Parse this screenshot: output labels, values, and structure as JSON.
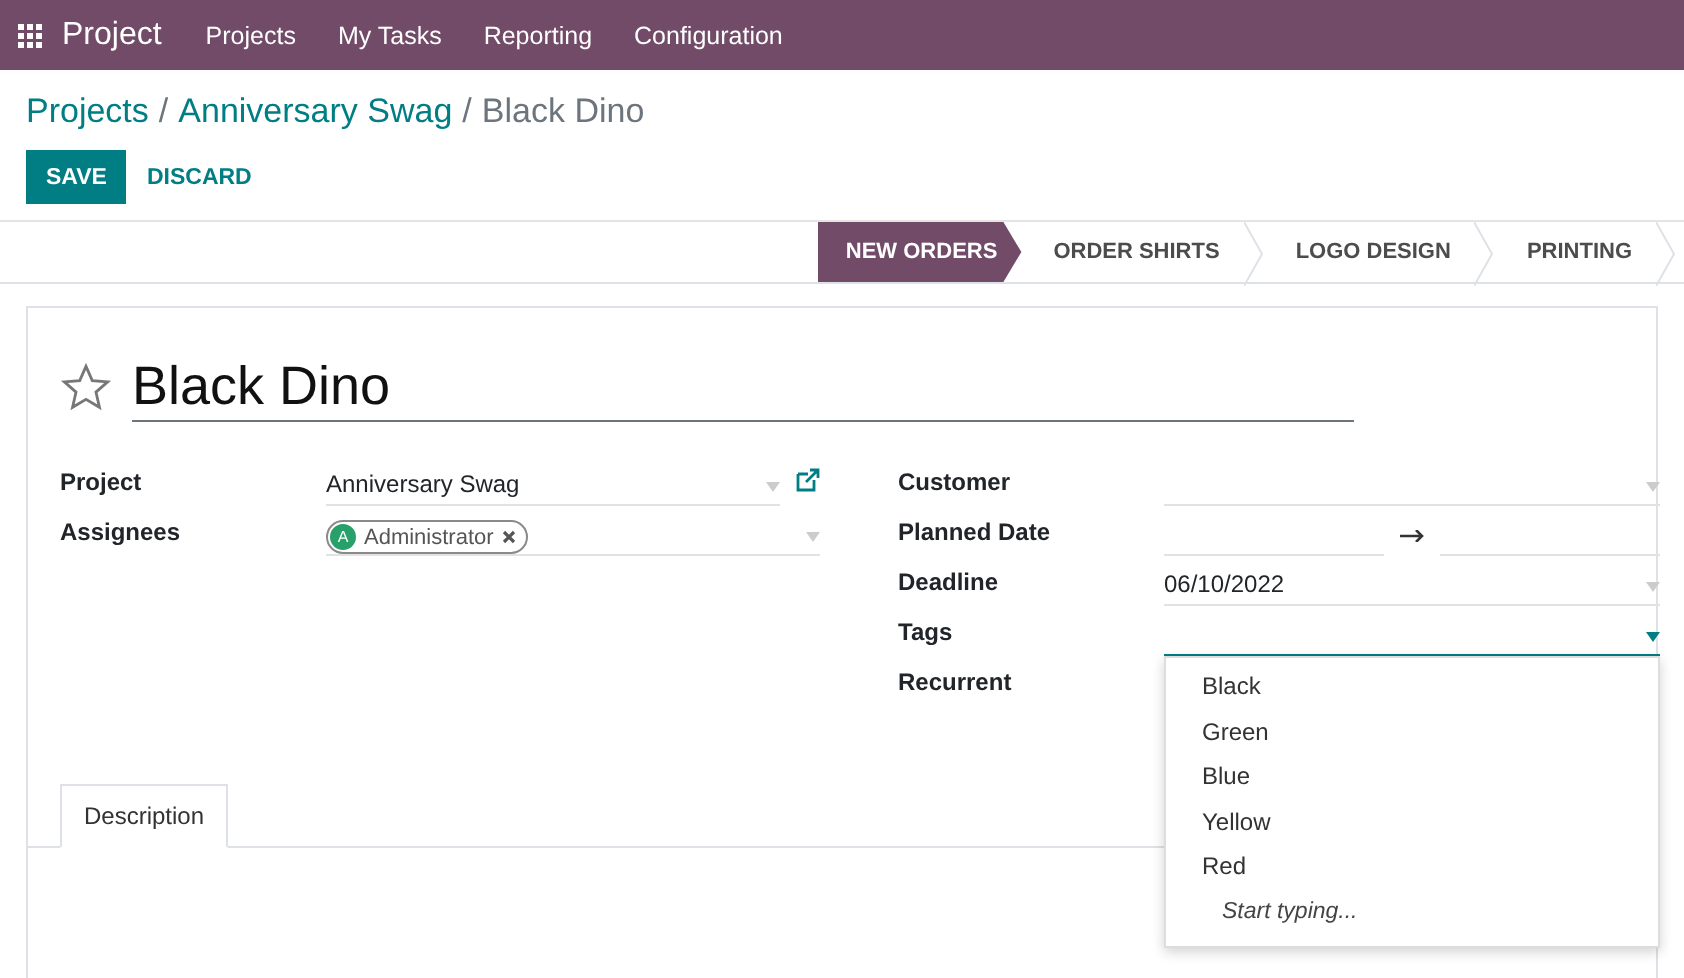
{
  "navbar": {
    "app_title": "Project",
    "menu": [
      "Projects",
      "My Tasks",
      "Reporting",
      "Configuration"
    ]
  },
  "breadcrumb_separator": "/",
  "breadcrumb": [
    {
      "label": "Projects",
      "link": true
    },
    {
      "label": "Anniversary Swag",
      "link": true
    },
    {
      "label": "Black Dino",
      "link": false
    }
  ],
  "buttons": [
    {
      "label": "SAVE",
      "kind": "primary"
    },
    {
      "label": "DISCARD",
      "kind": "link"
    }
  ],
  "stages": [
    {
      "label": "NEW ORDERS",
      "selected": true
    },
    {
      "label": "ORDER SHIRTS",
      "selected": false
    },
    {
      "label": "LOGO DESIGN",
      "selected": false
    },
    {
      "label": "PRINTING",
      "selected": false
    }
  ],
  "task": {
    "title": "Black Dino",
    "starred": false
  },
  "left_fields": [
    {
      "label": "Project",
      "kind": "select",
      "value": "Anniversary Swag",
      "external_link": true
    },
    {
      "label": "Assignees",
      "kind": "tags",
      "tags": [
        {
          "initial": "A",
          "name": "Administrator",
          "color": "#28a06a"
        }
      ]
    }
  ],
  "right_fields": [
    {
      "label": "Customer",
      "kind": "select"
    },
    {
      "label": "Planned Date",
      "kind": "range"
    },
    {
      "label": "Deadline",
      "kind": "select",
      "value": "06/10/2022"
    },
    {
      "label": "Tags",
      "kind": "select",
      "focused": true,
      "dropdown": {
        "options": [
          "Black",
          "Green",
          "Blue",
          "Yellow",
          "Red"
        ],
        "hint": "Start typing..."
      }
    },
    {
      "label": "Recurrent",
      "kind": "none"
    }
  ],
  "notebook_tabs": [
    {
      "label": "Description",
      "selected": true
    }
  ]
}
